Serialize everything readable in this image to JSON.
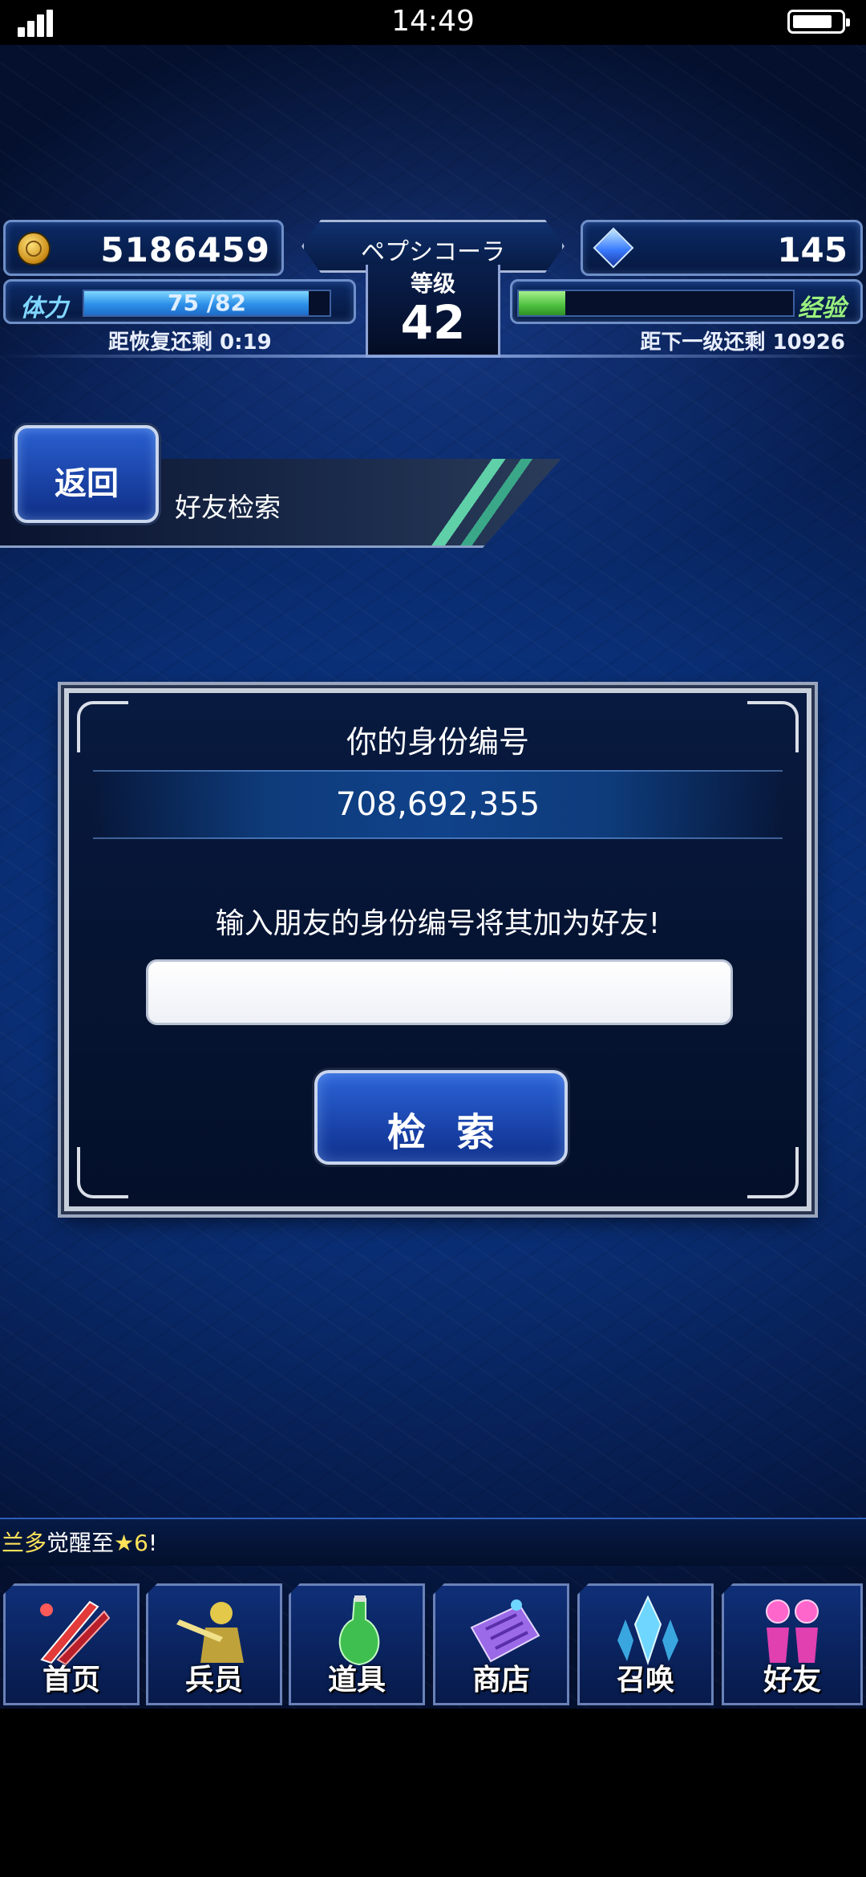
{
  "status_bar": {
    "time": "14:49"
  },
  "hud": {
    "gil": "5186459",
    "player_name": "ペプシコーラ",
    "rank_label": "等级",
    "rank": "42",
    "gems": "145",
    "stamina_label": "体力",
    "stamina_text": "75 /82",
    "stamina_fraction": 0.915,
    "stamina_recover": "距恢复还剩 0:19",
    "exp_label": "经验",
    "exp_fraction": 0.17,
    "exp_remaining": "距下一级还剩 10926"
  },
  "header": {
    "back_label": "返回",
    "title": "好友检索"
  },
  "dialog": {
    "id_title": "你的身份编号",
    "id_value": "708,692,355",
    "prompt": "输入朋友的身份编号将其加为好友!",
    "input_value": "",
    "search_label": "检索"
  },
  "ticker": {
    "prefix": "兰多",
    "text": "觉醒至",
    "star": "★6",
    "suffix": "!"
  },
  "nav": [
    {
      "label": "首页",
      "icon": "sword-icon",
      "color": "#e33a3a"
    },
    {
      "label": "兵员",
      "icon": "warrior-icon",
      "color": "#e3c84a"
    },
    {
      "label": "道具",
      "icon": "potion-icon",
      "color": "#3fbf4f"
    },
    {
      "label": "商店",
      "icon": "shop-icon",
      "color": "#9a6ae8"
    },
    {
      "label": "召唤",
      "icon": "crystal-icon",
      "color": "#6fd6ff"
    },
    {
      "label": "好友",
      "icon": "friends-icon",
      "color": "#ff66cc"
    }
  ]
}
